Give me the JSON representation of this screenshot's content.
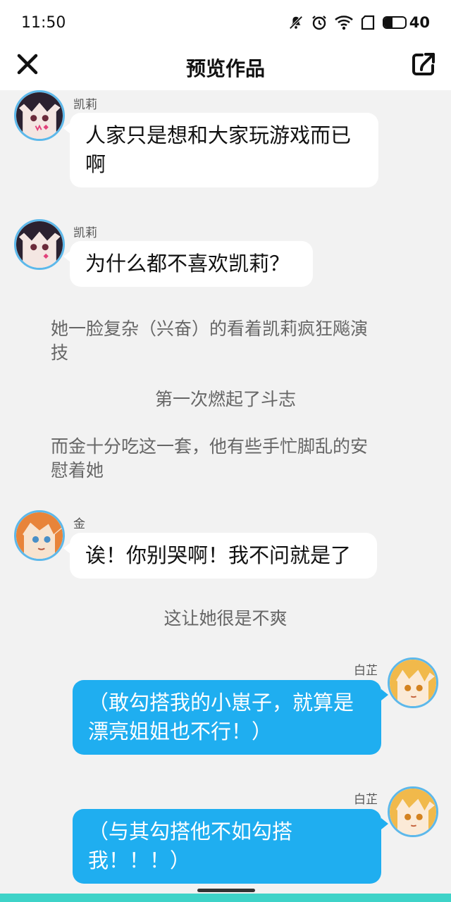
{
  "status_bar": {
    "time": "11:50",
    "battery_level": "40",
    "battery_fraction": 0.4,
    "icons": [
      "mute-bell-icon",
      "alarm-icon",
      "wifi-icon",
      "sim-icon",
      "battery-icon"
    ]
  },
  "header": {
    "title": "预览作品",
    "close_icon": "close-icon",
    "share_icon": "share-icon"
  },
  "messages": [
    {
      "speaker": "凯莉",
      "text": "人家只是想和大家玩游戏而已啊",
      "line1": "人家只是想和大家玩游戏而已",
      "line2": "啊"
    },
    {
      "speaker": "凯莉",
      "text": "为什么都不喜欢凯莉？"
    },
    {
      "speaker": "金",
      "text": "诶！你别哭啊！我不问就是了"
    },
    {
      "speaker": "白芷",
      "text": "（敢勾搭我的小崽子，就算是漂亮姐姐也不行！）",
      "line1": "（敢勾搭我的小崽子，就算是",
      "line2": "漂亮姐姐也不行！）"
    },
    {
      "speaker": "白芷",
      "text": "（与其勾搭他不如勾搭我！！！）",
      "line1": "（与其勾搭他不如勾搭",
      "line2": "我！！！）"
    }
  ],
  "narrations": [
    {
      "line1": "她一脸复杂（兴奋）的看着凯莉疯狂飚演",
      "line2": "技"
    },
    {
      "text": "第一次燃起了斗志"
    },
    {
      "line1": "而金十分吃这一套，他有些手忙脚乱的安",
      "line2": "慰着她"
    },
    {
      "text": "这让她很是不爽"
    }
  ],
  "colors": {
    "left_bubble": "#ffffff",
    "right_bubble": "#1faef0",
    "avatar_ring": "#5db8ea",
    "background": "#f2f2f2"
  }
}
